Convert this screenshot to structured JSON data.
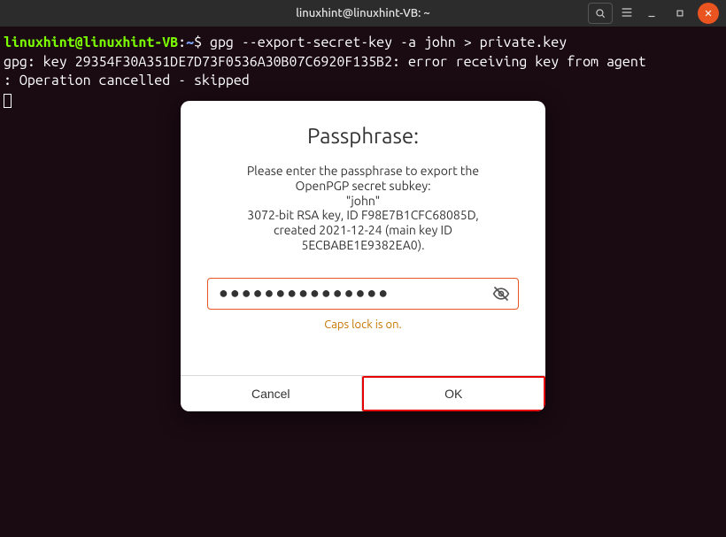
{
  "titlebar": {
    "title": "linuxhint@linuxhint-VB: ~"
  },
  "terminal": {
    "user_host": "linuxhint@linuxhint-VB",
    "path": "~",
    "prompt_char": "$",
    "command": "gpg --export-secret-key -a john > private.key",
    "line2": "gpg: key 29354F30A351DE7D73F0536A30B07C6920F135B2: error receiving key from agent",
    "line3": ": Operation cancelled - skipped"
  },
  "dialog": {
    "title": "Passphrase:",
    "text_l1": "Please enter the passphrase to export the",
    "text_l2": "OpenPGP secret subkey:",
    "text_l3": "\"john\"",
    "text_l4": "3072-bit RSA key, ID F98E7B1CFC68085D,",
    "text_l5": "created 2021-12-24 (main key ID",
    "text_l6": "5ECBABE1E9382EA0).",
    "password_value": "●●●●●●●●●●●●●●●",
    "caps_warning": "Caps lock is on.",
    "cancel_label": "Cancel",
    "ok_label": "OK"
  }
}
